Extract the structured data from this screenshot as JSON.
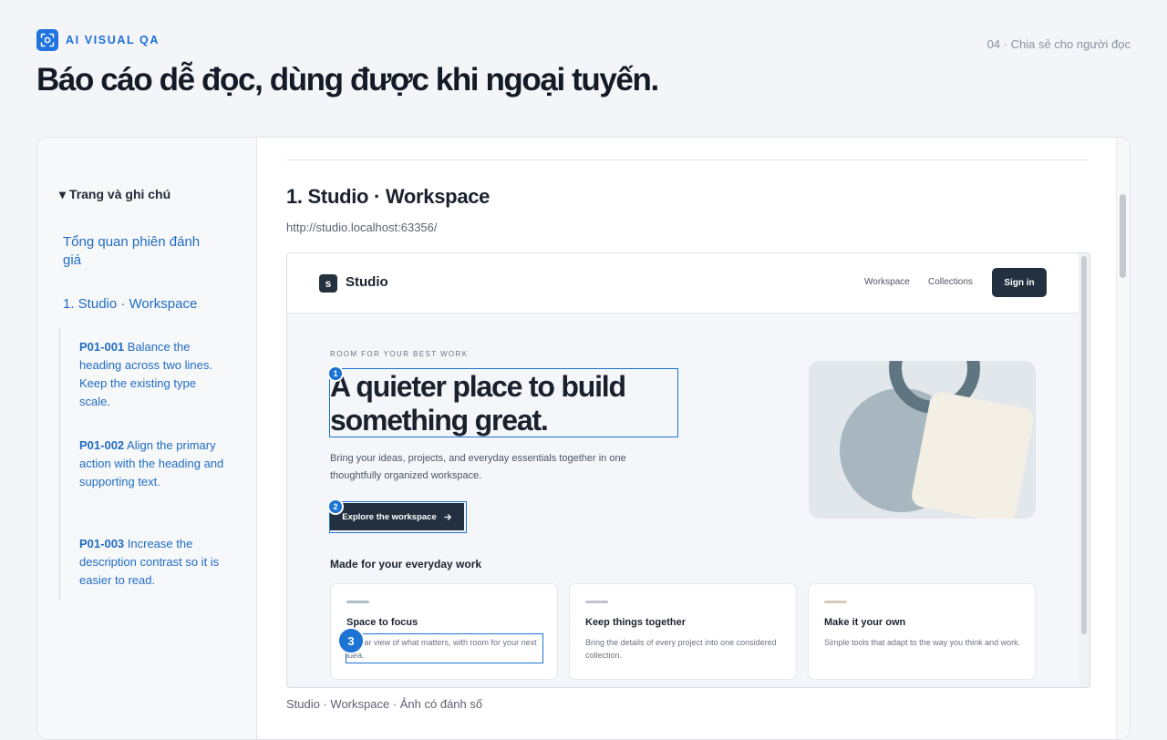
{
  "brand": {
    "name": "AI VISUAL QA",
    "logo_icon": "viewfinder-icon",
    "accent": "#1f74e0"
  },
  "slide_label": "04 · Chia sẻ cho người đọc",
  "headline": "Báo cáo dễ đọc, dùng được khi ngoại tuyến.",
  "sidebar": {
    "toggle_label": "▾ Trang và ghi chú",
    "links": [
      "Tổng quan phiên đánh giá",
      "1. Studio · Workspace"
    ],
    "notes": [
      {
        "id": "P01-001",
        "text": " Balance the heading across two lines. Keep the existing type scale."
      },
      {
        "id": "P01-002",
        "text": " Align the primary action with the heading and supporting text."
      },
      {
        "id": "P01-003",
        "text": " Increase the description contrast so it is easier to read."
      }
    ]
  },
  "section": {
    "title": "1. Studio · Workspace",
    "url": "http://studio.localhost:63356/",
    "caption": "Studio · Workspace · Ảnh có đánh số"
  },
  "screenshot": {
    "logo_letter": "s",
    "brand": "Studio",
    "nav": [
      "Workspace",
      "Collections"
    ],
    "signin": "Sign in",
    "kicker": "ROOM FOR YOUR BEST WORK",
    "hero": "A quieter place to build something great.",
    "description": "Bring your ideas, projects, and everyday essentials together in one thoughtfully organized workspace.",
    "cta": "Explore the workspace",
    "cta_icon": "arrow-right-icon",
    "section_title": "Made for your everyday work",
    "cards": [
      {
        "title": "Space to focus",
        "desc": "A clear view of what matters, with room for your next idea.",
        "accent": "#aebfc6"
      },
      {
        "title": "Keep things together",
        "desc": "Bring the details of every project into one considered collection.",
        "accent": "#c3c1cf"
      },
      {
        "title": "Make it your own",
        "desc": "Simple tools that adapt to the way you think and work.",
        "accent": "#d6cbb8"
      }
    ],
    "annotations": [
      "1",
      "2",
      "3"
    ],
    "highlight_color": "#1b73d4"
  }
}
